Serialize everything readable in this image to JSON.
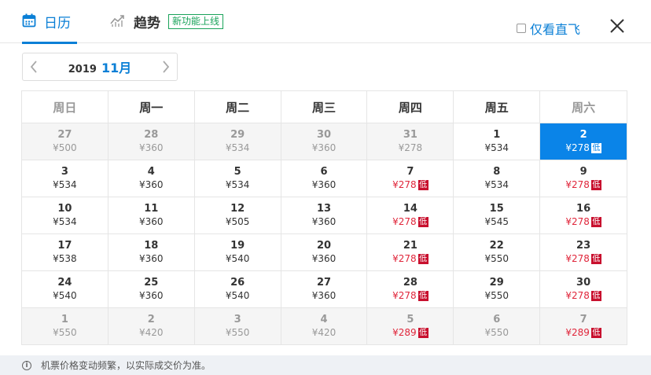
{
  "tabs": {
    "calendar_label": "日历",
    "trend_label": "趋势",
    "new_badge": "新功能上线"
  },
  "direct_only_label": "仅看直飞",
  "nav": {
    "year": "2019",
    "month": "11月"
  },
  "weekdays": [
    "周日",
    "周一",
    "周二",
    "周三",
    "周四",
    "周五",
    "周六"
  ],
  "weeks": [
    [
      {
        "day": "27",
        "price": "¥500",
        "low": false,
        "out": true
      },
      {
        "day": "28",
        "price": "¥360",
        "low": false,
        "out": true
      },
      {
        "day": "29",
        "price": "¥534",
        "low": false,
        "out": true
      },
      {
        "day": "30",
        "price": "¥360",
        "low": false,
        "out": true
      },
      {
        "day": "31",
        "price": "¥278",
        "low": false,
        "out": true
      },
      {
        "day": "1",
        "price": "¥534",
        "low": false,
        "out": false
      },
      {
        "day": "2",
        "price": "¥278",
        "low": true,
        "out": false,
        "selected": true
      }
    ],
    [
      {
        "day": "3",
        "price": "¥534",
        "low": false
      },
      {
        "day": "4",
        "price": "¥360",
        "low": false
      },
      {
        "day": "5",
        "price": "¥534",
        "low": false
      },
      {
        "day": "6",
        "price": "¥360",
        "low": false
      },
      {
        "day": "7",
        "price": "¥278",
        "low": true
      },
      {
        "day": "8",
        "price": "¥534",
        "low": false
      },
      {
        "day": "9",
        "price": "¥278",
        "low": true
      }
    ],
    [
      {
        "day": "10",
        "price": "¥534",
        "low": false
      },
      {
        "day": "11",
        "price": "¥360",
        "low": false
      },
      {
        "day": "12",
        "price": "¥505",
        "low": false
      },
      {
        "day": "13",
        "price": "¥360",
        "low": false
      },
      {
        "day": "14",
        "price": "¥278",
        "low": true
      },
      {
        "day": "15",
        "price": "¥545",
        "low": false
      },
      {
        "day": "16",
        "price": "¥278",
        "low": true
      }
    ],
    [
      {
        "day": "17",
        "price": "¥538",
        "low": false
      },
      {
        "day": "18",
        "price": "¥360",
        "low": false
      },
      {
        "day": "19",
        "price": "¥540",
        "low": false
      },
      {
        "day": "20",
        "price": "¥360",
        "low": false
      },
      {
        "day": "21",
        "price": "¥278",
        "low": true
      },
      {
        "day": "22",
        "price": "¥550",
        "low": false
      },
      {
        "day": "23",
        "price": "¥278",
        "low": true
      }
    ],
    [
      {
        "day": "24",
        "price": "¥540",
        "low": false
      },
      {
        "day": "25",
        "price": "¥360",
        "low": false
      },
      {
        "day": "26",
        "price": "¥540",
        "low": false
      },
      {
        "day": "27",
        "price": "¥360",
        "low": false
      },
      {
        "day": "28",
        "price": "¥278",
        "low": true
      },
      {
        "day": "29",
        "price": "¥550",
        "low": false
      },
      {
        "day": "30",
        "price": "¥278",
        "low": true
      }
    ],
    [
      {
        "day": "1",
        "price": "¥550",
        "low": false,
        "out": true
      },
      {
        "day": "2",
        "price": "¥420",
        "low": false,
        "out": true
      },
      {
        "day": "3",
        "price": "¥550",
        "low": false,
        "out": true
      },
      {
        "day": "4",
        "price": "¥420",
        "low": false,
        "out": true
      },
      {
        "day": "5",
        "price": "¥289",
        "low": true,
        "out": true
      },
      {
        "day": "6",
        "price": "¥550",
        "low": false,
        "out": true
      },
      {
        "day": "7",
        "price": "¥289",
        "low": true,
        "out": true
      }
    ]
  ],
  "low_tag": "低",
  "footer_text": "机票价格变动频繁，以实际成交价为准。",
  "colors": {
    "accent": "#0a7fd6",
    "selected_bg": "#0a84e8",
    "low_price": "#e0263b",
    "low_tag_bg": "#c8102e",
    "new_badge": "#1aa35a"
  },
  "icons": {
    "calendar": "calendar-icon",
    "trend": "trend-chart-icon",
    "close": "close-icon",
    "prev": "chevron-left-icon",
    "next": "chevron-right-icon",
    "info": "info-icon"
  }
}
